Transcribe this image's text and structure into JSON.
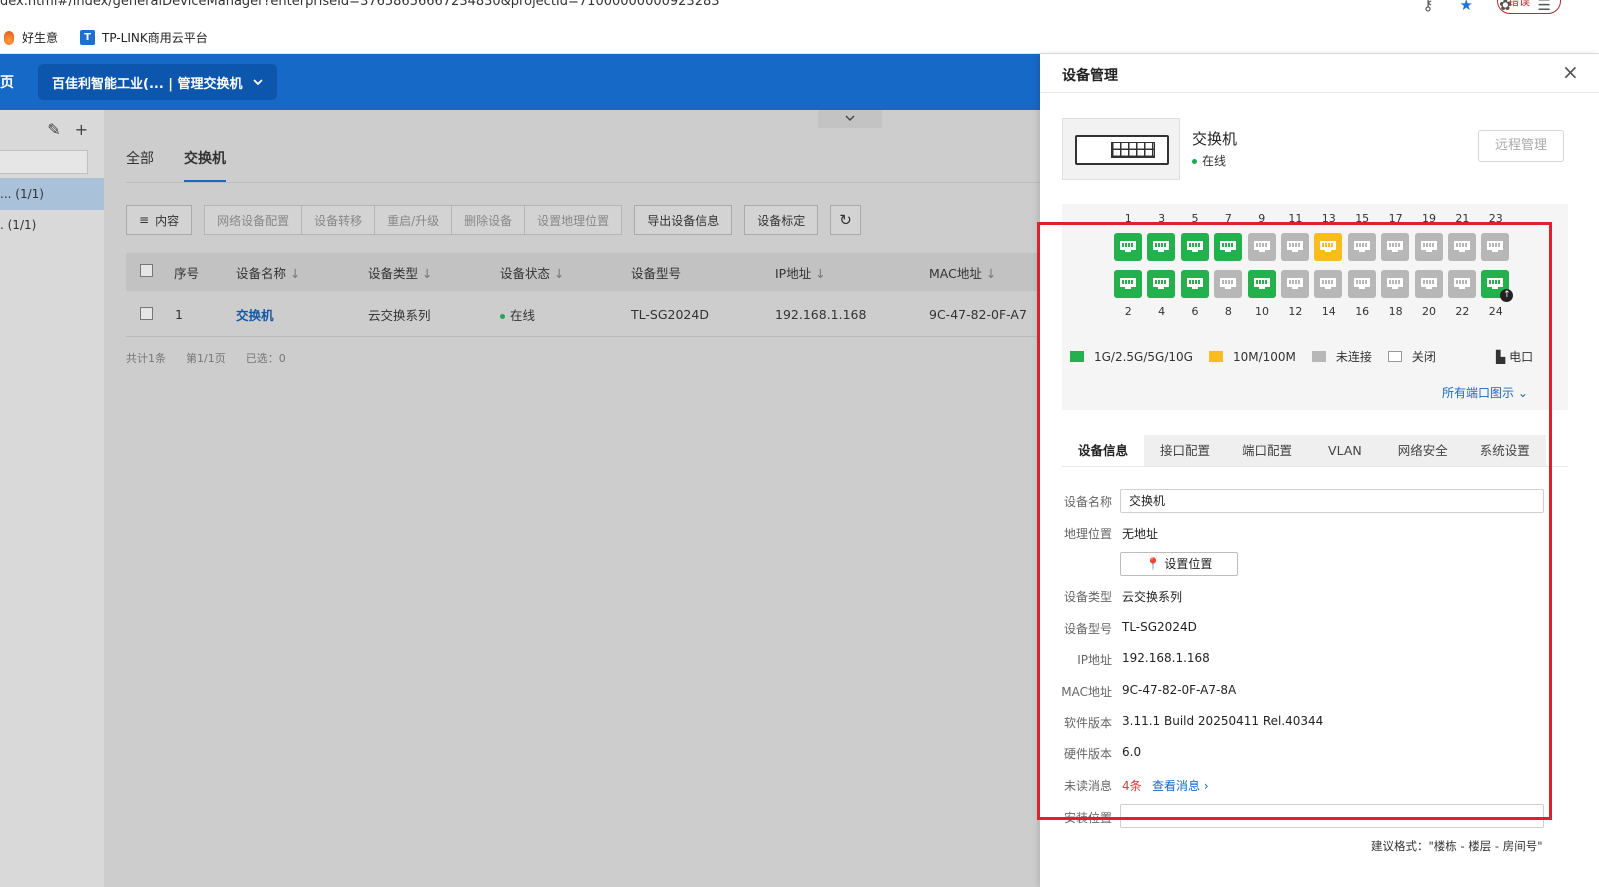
{
  "browser": {
    "url": "dex.html#/index/generalDeviceManager?enterpriseId=37658656667234830&projectId=71000000000923283",
    "account_label": "错误",
    "bookmarks": [
      {
        "label": "好生意"
      },
      {
        "label": "TP-LINK商用云平台",
        "icon": "T"
      }
    ]
  },
  "header": {
    "home": "页",
    "project": "百佳利智能工业(... | 管理交换机"
  },
  "sidebar": {
    "groups": [
      {
        "label": "... (1/1)"
      },
      {
        "label": ". (1/1)"
      }
    ]
  },
  "main": {
    "tabs": [
      {
        "label": "全部"
      },
      {
        "label": "交换机"
      }
    ],
    "toolbar": {
      "content": "内容",
      "network_config": "网络设备配置",
      "transfer": "设备转移",
      "reboot": "重启/升级",
      "delete": "删除设备",
      "set_location": "设置地理位置",
      "export": "导出设备信息",
      "calibrate": "设备标定"
    },
    "table": {
      "columns": [
        "序号",
        "设备名称",
        "设备类型",
        "设备状态",
        "设备型号",
        "IP地址",
        "MAC地址"
      ],
      "rows": [
        {
          "index": "1",
          "name": "交换机",
          "type": "云交换系列",
          "status": "在线",
          "model": "TL-SG2024D",
          "ip": "192.168.1.168",
          "mac": "9C-47-82-0F-A7"
        }
      ]
    },
    "summary": {
      "total": "共计1条",
      "page": "第1/1页",
      "selected": "已选：0"
    }
  },
  "drawer": {
    "title": "设备管理",
    "device_name": "交换机",
    "device_status": "在线",
    "remote_manage": "远程管理",
    "ports_top_labels": [
      "1",
      "3",
      "5",
      "7",
      "9",
      "11",
      "13",
      "15",
      "17",
      "19",
      "21",
      "23"
    ],
    "ports_bottom_labels": [
      "2",
      "4",
      "6",
      "8",
      "10",
      "12",
      "14",
      "16",
      "18",
      "20",
      "22",
      "24"
    ],
    "ports_top_states": [
      "g",
      "g",
      "g",
      "g",
      "n",
      "n",
      "y",
      "n",
      "n",
      "n",
      "n",
      "n"
    ],
    "ports_bottom_states": [
      "g",
      "g",
      "g",
      "n",
      "g",
      "n",
      "n",
      "n",
      "n",
      "n",
      "n",
      "g"
    ],
    "legend": {
      "fast": "1G/2.5G/5G/10G",
      "slow": "10M/100M",
      "disconnected": "未连接",
      "off": "关闭",
      "electrical": "电口"
    },
    "all_ports": "所有端口图示",
    "tabs": [
      "设备信息",
      "接口配置",
      "端口配置",
      "VLAN",
      "网络安全",
      "系统设置"
    ],
    "info": {
      "name_label": "设备名称",
      "name_value": "交换机",
      "location_label": "地理位置",
      "location_value": "无地址",
      "set_location": "设置位置",
      "type_label": "设备类型",
      "type_value": "云交换系列",
      "model_label": "设备型号",
      "model_value": "TL-SG2024D",
      "ip_label": "IP地址",
      "ip_value": "192.168.1.168",
      "mac_label": "MAC地址",
      "mac_value": "9C-47-82-0F-A7-8A",
      "sw_label": "软件版本",
      "sw_value": "3.11.1 Build 20250411 Rel.40344",
      "hw_label": "硬件版本",
      "hw_value": "6.0",
      "unread_label": "未读消息",
      "unread_value": "4条",
      "view_messages": "查看消息",
      "install_label": "安装位置",
      "install_hint": "建议格式：\"楼栋 - 楼层 - 房间号\""
    }
  },
  "colors": {
    "brand": "#1769c8",
    "port_fast": "#22b14c",
    "port_slow": "#f8bd1c",
    "port_none": "#b7b7b7",
    "highlight": "#e0202a"
  }
}
